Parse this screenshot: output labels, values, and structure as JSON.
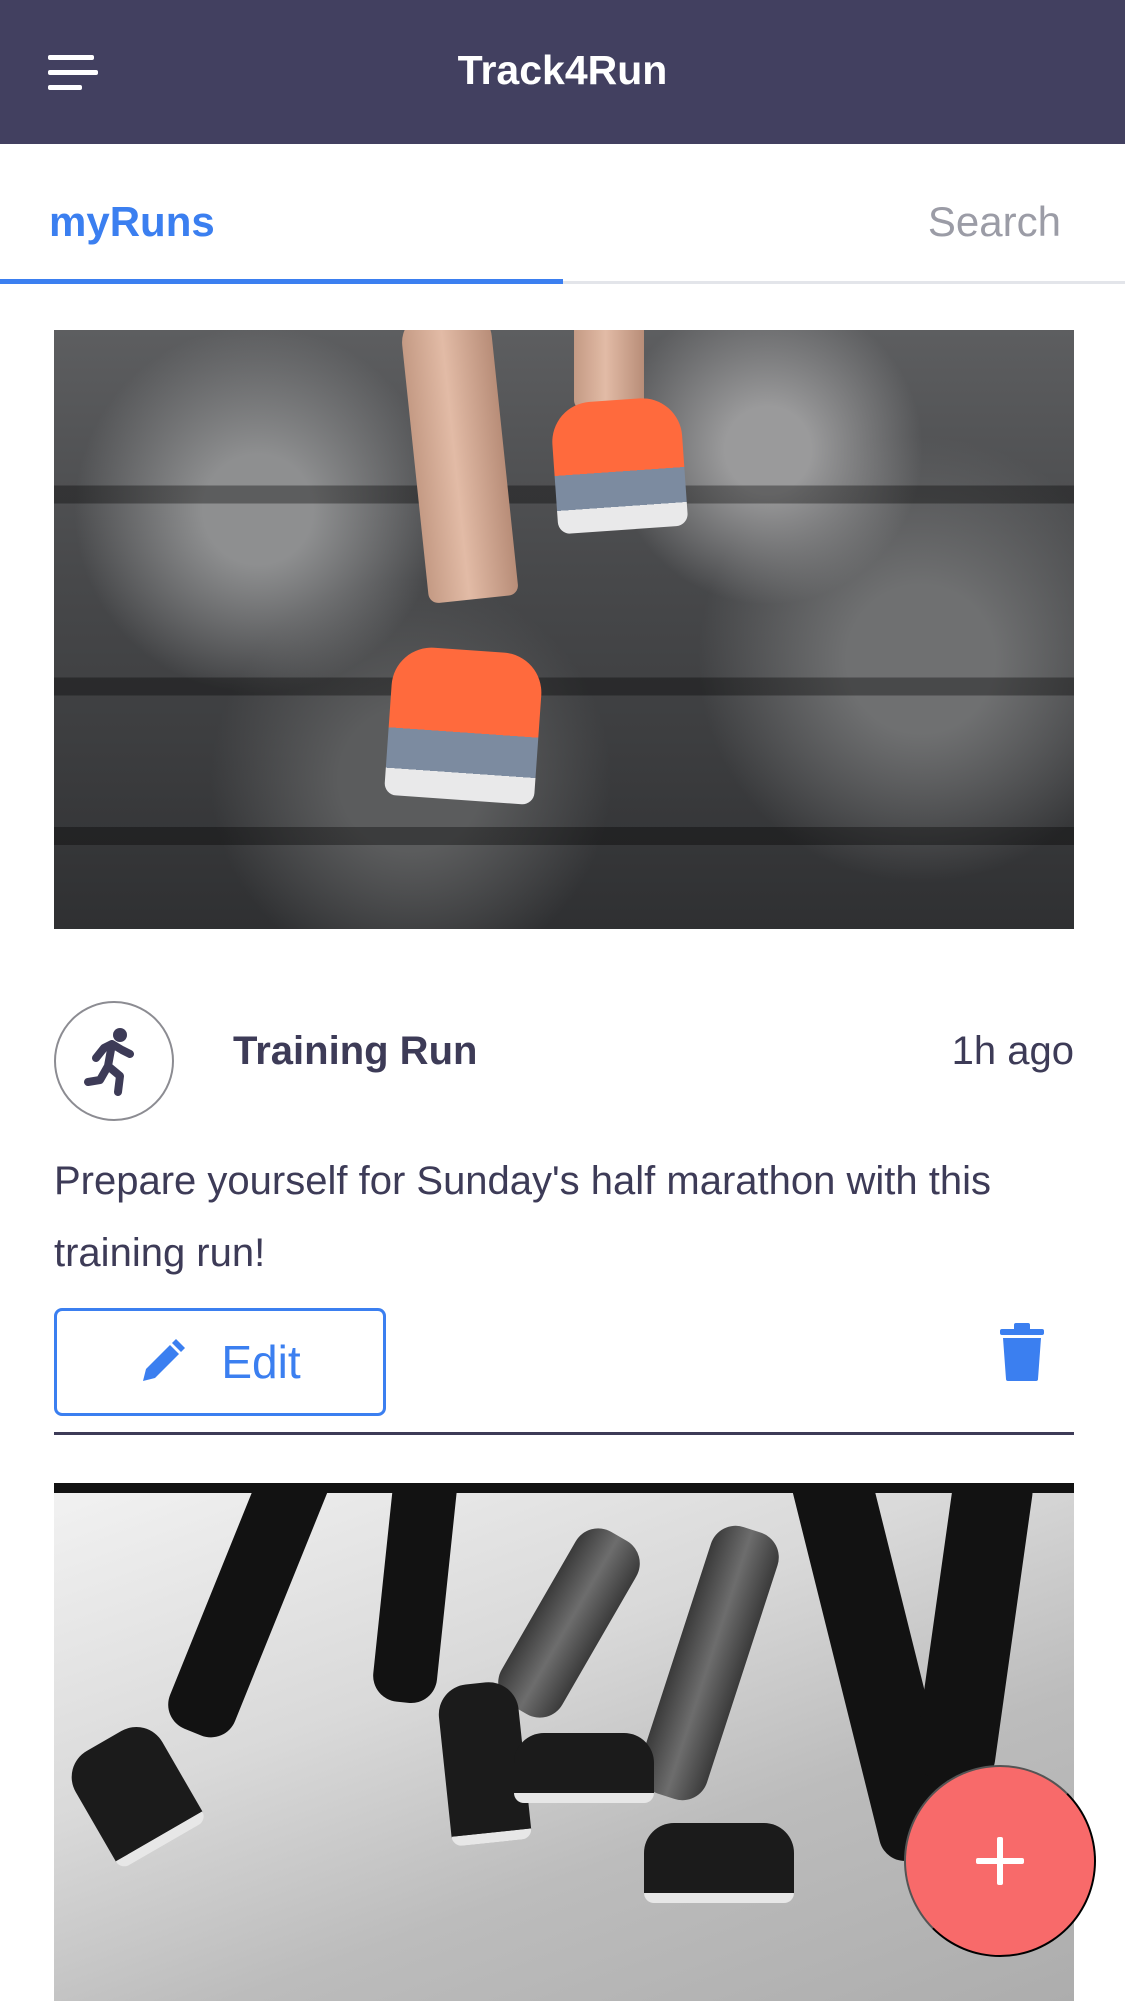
{
  "header": {
    "title": "Track4Run",
    "menu_icon": "hamburger-menu-icon"
  },
  "tabs": [
    {
      "label": "myRuns",
      "active": true
    },
    {
      "label": "Search",
      "active": false
    }
  ],
  "runs": [
    {
      "title": "Training Run",
      "time": "1h ago",
      "description": "Prepare yourself for Sunday's half marathon with this training run!",
      "edit_label": "Edit",
      "avatar_icon": "runner-icon",
      "edit_icon": "pencil-icon",
      "delete_icon": "trash-icon"
    }
  ],
  "fab": {
    "icon": "plus-icon"
  },
  "colors": {
    "header_bg": "#424060",
    "accent": "#3b7ff0",
    "fab": "#f86a6a",
    "text": "#3d3b57"
  }
}
